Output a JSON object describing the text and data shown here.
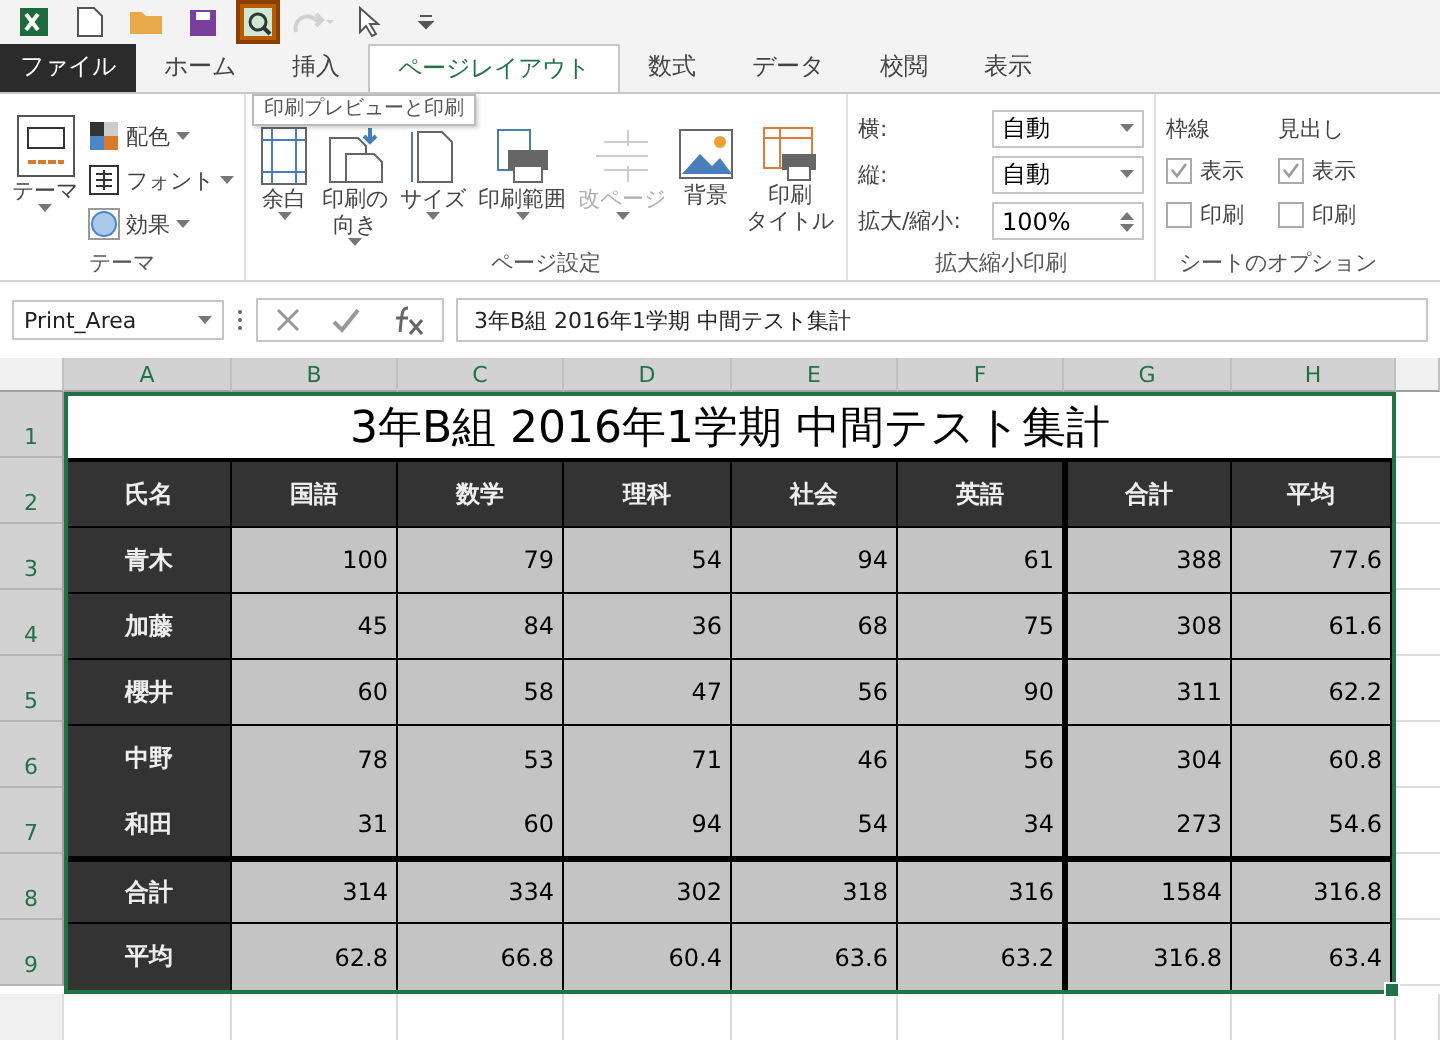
{
  "quick_access": {
    "items": [
      {
        "kind": "logo",
        "active": false,
        "disabled": false
      },
      {
        "kind": "new",
        "active": false,
        "disabled": false
      },
      {
        "kind": "open",
        "active": false,
        "disabled": false
      },
      {
        "kind": "save",
        "active": false,
        "disabled": false
      },
      {
        "kind": "preview",
        "active": true,
        "disabled": false
      },
      {
        "kind": "redo",
        "active": false,
        "disabled": true
      },
      {
        "kind": "pointer",
        "active": false,
        "disabled": false
      },
      {
        "kind": "customize",
        "active": false,
        "disabled": false
      }
    ],
    "tooltip": "印刷プレビューと印刷"
  },
  "tabs": [
    {
      "label": "ファイル",
      "kind": "file",
      "selected": false
    },
    {
      "label": "ホーム",
      "kind": "tab",
      "selected": false
    },
    {
      "label": "挿入",
      "kind": "tab",
      "selected": false
    },
    {
      "label": "ページレイアウト",
      "kind": "tab",
      "selected": true
    },
    {
      "label": "数式",
      "kind": "tab",
      "selected": false
    },
    {
      "label": "データ",
      "kind": "tab",
      "selected": false
    },
    {
      "label": "校閲",
      "kind": "tab",
      "selected": false
    },
    {
      "label": "表示",
      "kind": "tab",
      "selected": false
    }
  ],
  "theme_group": {
    "label": "テーマ",
    "main": "テーマ",
    "items": [
      {
        "label": "配色",
        "kind": "colors"
      },
      {
        "label": "フォント",
        "kind": "fonts"
      },
      {
        "label": "効果",
        "kind": "effects"
      }
    ]
  },
  "page_setup": {
    "label": "ページ設定",
    "buttons": [
      {
        "lines": [
          "余白"
        ],
        "kind": "margins",
        "disabled": false,
        "dropdown": true
      },
      {
        "lines": [
          "印刷の",
          "向き"
        ],
        "kind": "orientation",
        "disabled": false,
        "dropdown": true
      },
      {
        "lines": [
          "サイズ"
        ],
        "kind": "size",
        "disabled": false,
        "dropdown": true
      },
      {
        "lines": [
          "印刷範囲"
        ],
        "kind": "area",
        "disabled": false,
        "dropdown": true
      },
      {
        "lines": [
          "改ページ"
        ],
        "kind": "breaks",
        "disabled": true,
        "dropdown": true
      },
      {
        "lines": [
          "背景"
        ],
        "kind": "background",
        "disabled": false,
        "dropdown": false
      },
      {
        "lines": [
          "印刷",
          "タイトル"
        ],
        "kind": "titles",
        "disabled": false,
        "dropdown": false
      }
    ]
  },
  "scale_group": {
    "label": "拡大縮小印刷",
    "rows": [
      {
        "label": "横:",
        "value": "自動",
        "kind": "dropdown"
      },
      {
        "label": "縦:",
        "value": "自動",
        "kind": "dropdown"
      },
      {
        "label": "拡大/縮小:",
        "value": "100%",
        "kind": "spinner"
      }
    ]
  },
  "sheet_options": {
    "label": "シートのオプション",
    "columns": [
      {
        "heading": "枠線",
        "options": [
          {
            "label": "表示",
            "checked": true
          },
          {
            "label": "印刷",
            "checked": false
          }
        ]
      },
      {
        "heading": "見出し",
        "options": [
          {
            "label": "表示",
            "checked": true
          },
          {
            "label": "印刷",
            "checked": false
          }
        ]
      }
    ]
  },
  "formula_bar": {
    "name_box": "Print_Area",
    "formula": "3年B組 2016年1学期 中間テスト集計"
  },
  "sheet": {
    "columns": [
      "A",
      "B",
      "C",
      "D",
      "E",
      "F",
      "G",
      "H"
    ],
    "row_numbers": [
      "1",
      "2",
      "3",
      "4",
      "5",
      "6",
      "7",
      "8",
      "9"
    ],
    "title": "3年B組 2016年1学期 中間テスト集計",
    "headers": [
      "氏名",
      "国語",
      "数学",
      "理科",
      "社会",
      "英語",
      "合計",
      "平均"
    ],
    "students": [
      [
        "青木",
        "100",
        "79",
        "54",
        "94",
        "61",
        "388",
        "77.6"
      ],
      [
        "加藤",
        "45",
        "84",
        "36",
        "68",
        "75",
        "308",
        "61.6"
      ],
      [
        "櫻井",
        "60",
        "58",
        "47",
        "56",
        "90",
        "311",
        "62.2"
      ],
      [
        "中野",
        "78",
        "53",
        "71",
        "46",
        "56",
        "304",
        "60.8"
      ],
      [
        "和田",
        "31",
        "60",
        "94",
        "54",
        "34",
        "273",
        "54.6"
      ]
    ],
    "summary": [
      [
        "合計",
        "314",
        "334",
        "302",
        "318",
        "316",
        "1584",
        "316.8"
      ],
      [
        "平均",
        "62.8",
        "66.8",
        "60.4",
        "63.6",
        "63.2",
        "316.8",
        "63.4"
      ]
    ]
  }
}
